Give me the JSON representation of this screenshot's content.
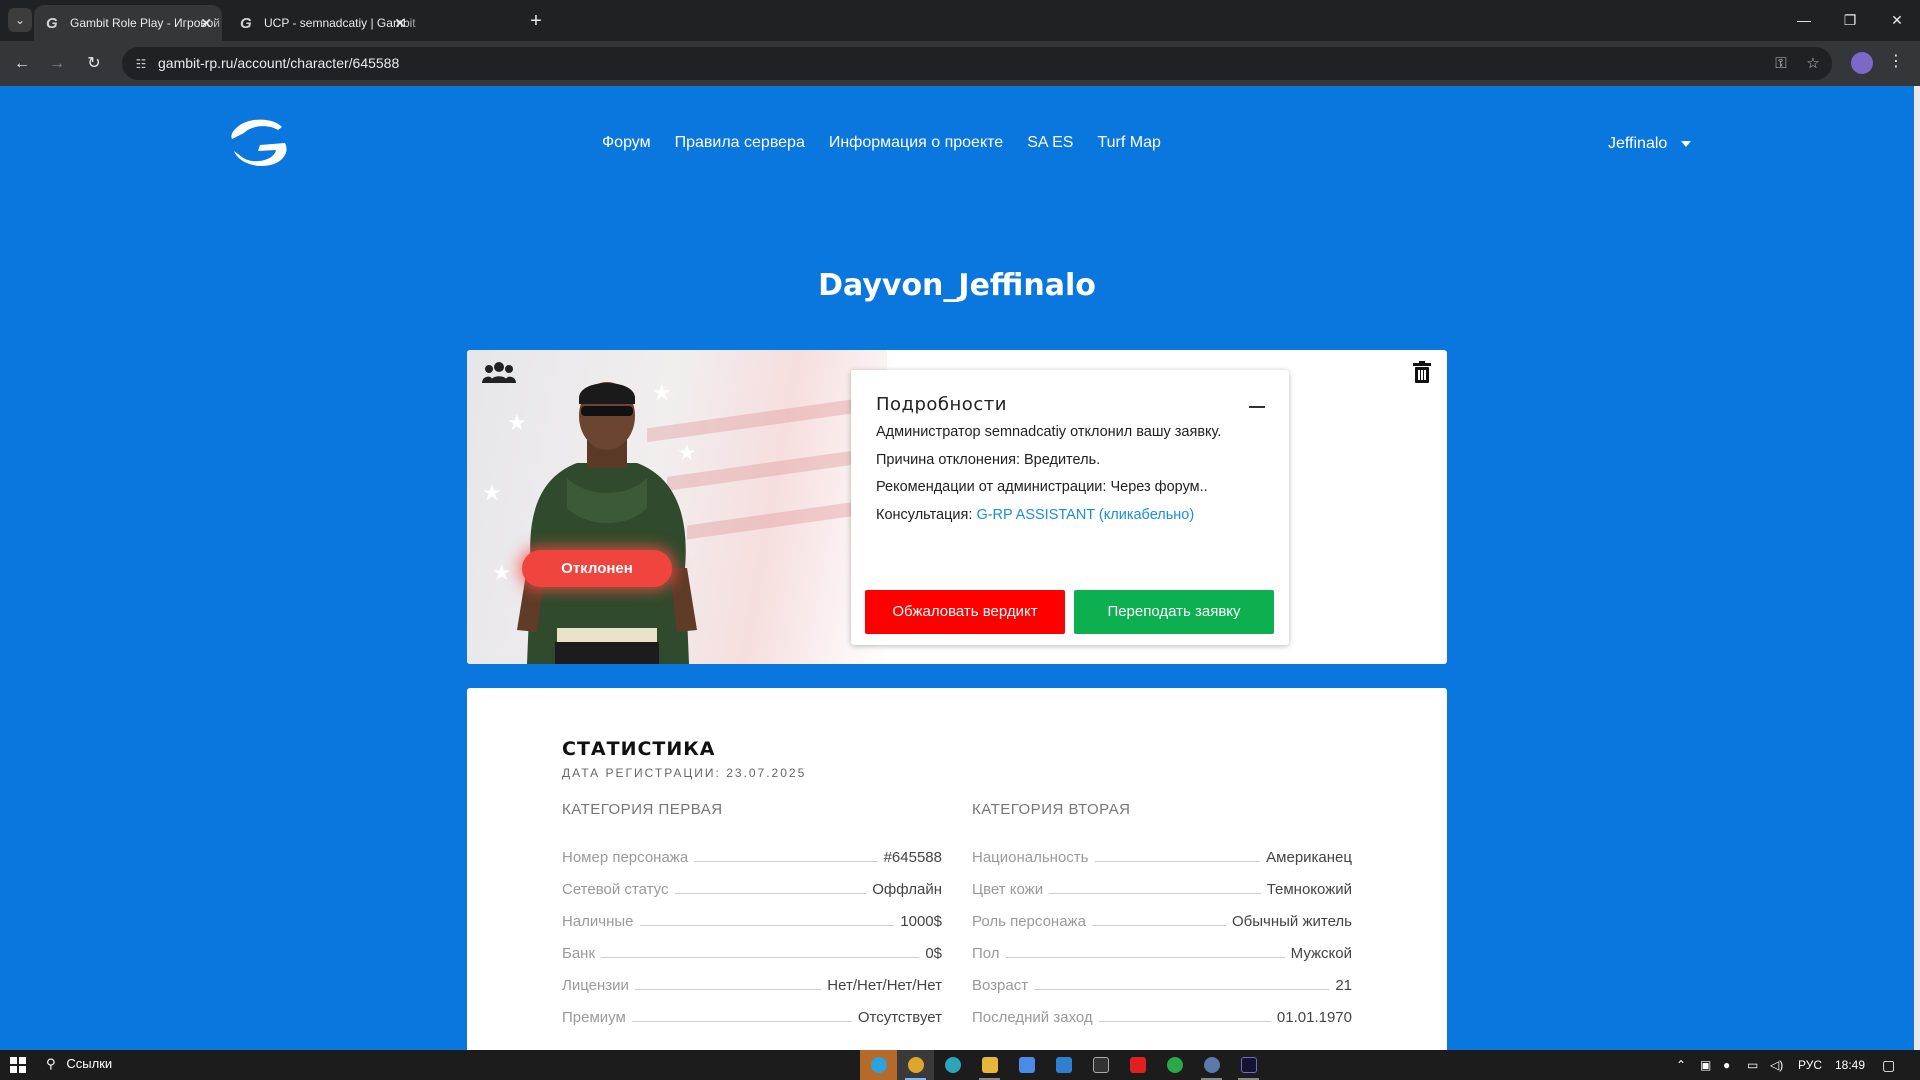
{
  "browser": {
    "tabs": [
      {
        "title": "Gambit Role Play - Игровой пр",
        "active": true
      },
      {
        "title": "UCP - semnadcatiy | Gambit Ro",
        "active": false
      }
    ],
    "url": "gambit-rp.ru/account/character/645588"
  },
  "nav": {
    "items": [
      "Форум",
      "Правила сервера",
      "Информация о проекте",
      "SA ES",
      "Turf Map"
    ],
    "user": "Jeffinalo"
  },
  "character": {
    "name": "Dayvon_Jeffinalo",
    "status_badge": "Отклонен"
  },
  "details": {
    "title": "Подробности",
    "line1": "Администратор semnadcatiy отклонил вашу заявку.",
    "line2": "Причина отклонения: Вредитель.",
    "line3": "Рекомендации от администрации: Через форум..",
    "consult_label": "Консультация:",
    "consult_link": "G-RP ASSISTANT (кликабельно)",
    "appeal_button": "Обжаловать вердикт",
    "resubmit_button": "Переподать заявку"
  },
  "stats": {
    "title": "СТАТИСТИКА",
    "reg_date": "ДАТА РЕГИСТРАЦИИ: 23.07.2025",
    "cat1": {
      "heading": "КАТЕГОРИЯ ПЕРВАЯ",
      "rows": [
        {
          "label": "Номер персонажа",
          "value": "#645588"
        },
        {
          "label": "Сетевой статус",
          "value": "Оффлайн"
        },
        {
          "label": "Наличные",
          "value": "1000$"
        },
        {
          "label": "Банк",
          "value": "0$"
        },
        {
          "label": "Лицензии",
          "value": "Нет/Нет/Нет/Нет"
        },
        {
          "label": "Премиум",
          "value": "Отсутствует"
        }
      ]
    },
    "cat2": {
      "heading": "КАТЕГОРИЯ ВТОРАЯ",
      "rows": [
        {
          "label": "Национальность",
          "value": "Американец"
        },
        {
          "label": "Цвет кожи",
          "value": "Темнокожий"
        },
        {
          "label": "Роль персонажа",
          "value": "Обычный житель"
        },
        {
          "label": "Пол",
          "value": "Мужской"
        },
        {
          "label": "Возраст",
          "value": "21"
        },
        {
          "label": "Последний заход",
          "value": "01.01.1970"
        }
      ]
    }
  },
  "taskbar": {
    "search": "Ссылки",
    "lang": "РУС",
    "time": "18:49"
  },
  "colors": {
    "page_bg": "#0a77df",
    "reject": "#fe0000",
    "resubmit": "#0cb050",
    "link": "#1a8fd8"
  }
}
